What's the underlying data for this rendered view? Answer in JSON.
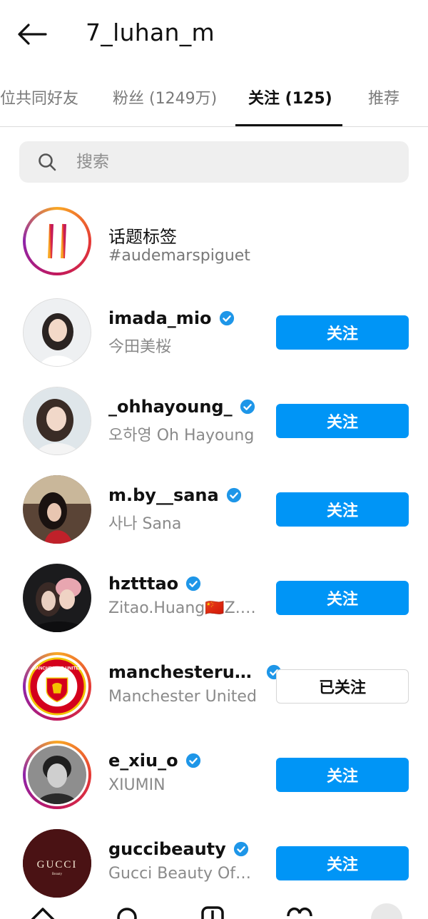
{
  "header": {
    "title": "7_luhan_m"
  },
  "tabs": [
    {
      "label": "位共同好友"
    },
    {
      "label": "粉丝 (1249万)"
    },
    {
      "label": "关注 (125)"
    },
    {
      "label": "推荐"
    }
  ],
  "search": {
    "placeholder": "搜索"
  },
  "list": [
    {
      "name": "话题标签",
      "sub": "#audemarspiguet",
      "type": "hashtag"
    },
    {
      "name": "imada_mio",
      "sub": "今田美桜",
      "verified": true,
      "button": "关注"
    },
    {
      "name": "_ohhayoung_",
      "sub": "오하영 Oh Hayoung",
      "verified": true,
      "button": "关注"
    },
    {
      "name": "m.by__sana",
      "sub": "사나 Sana",
      "verified": true,
      "button": "关注"
    },
    {
      "name": "hztttao",
      "sub": "Zitao.Huang🇨🇳Z.…",
      "verified": true,
      "button": "关注"
    },
    {
      "name": "manchesteru…",
      "sub": "Manchester United",
      "verified": true,
      "button": "已关注"
    },
    {
      "name": "e_xiu_o",
      "sub": "XIUMIN",
      "verified": true,
      "button": "关注"
    },
    {
      "name": "guccibeauty",
      "sub": "Gucci Beauty Of…",
      "verified": true,
      "button": "关注"
    }
  ],
  "logos": {
    "manutd": "MANCHESTER UNITED",
    "gucci": "GUCCI",
    "gucci_sub": "Beauty"
  },
  "colors": {
    "accent": "#0095f6",
    "verified": "#1e96e8"
  }
}
